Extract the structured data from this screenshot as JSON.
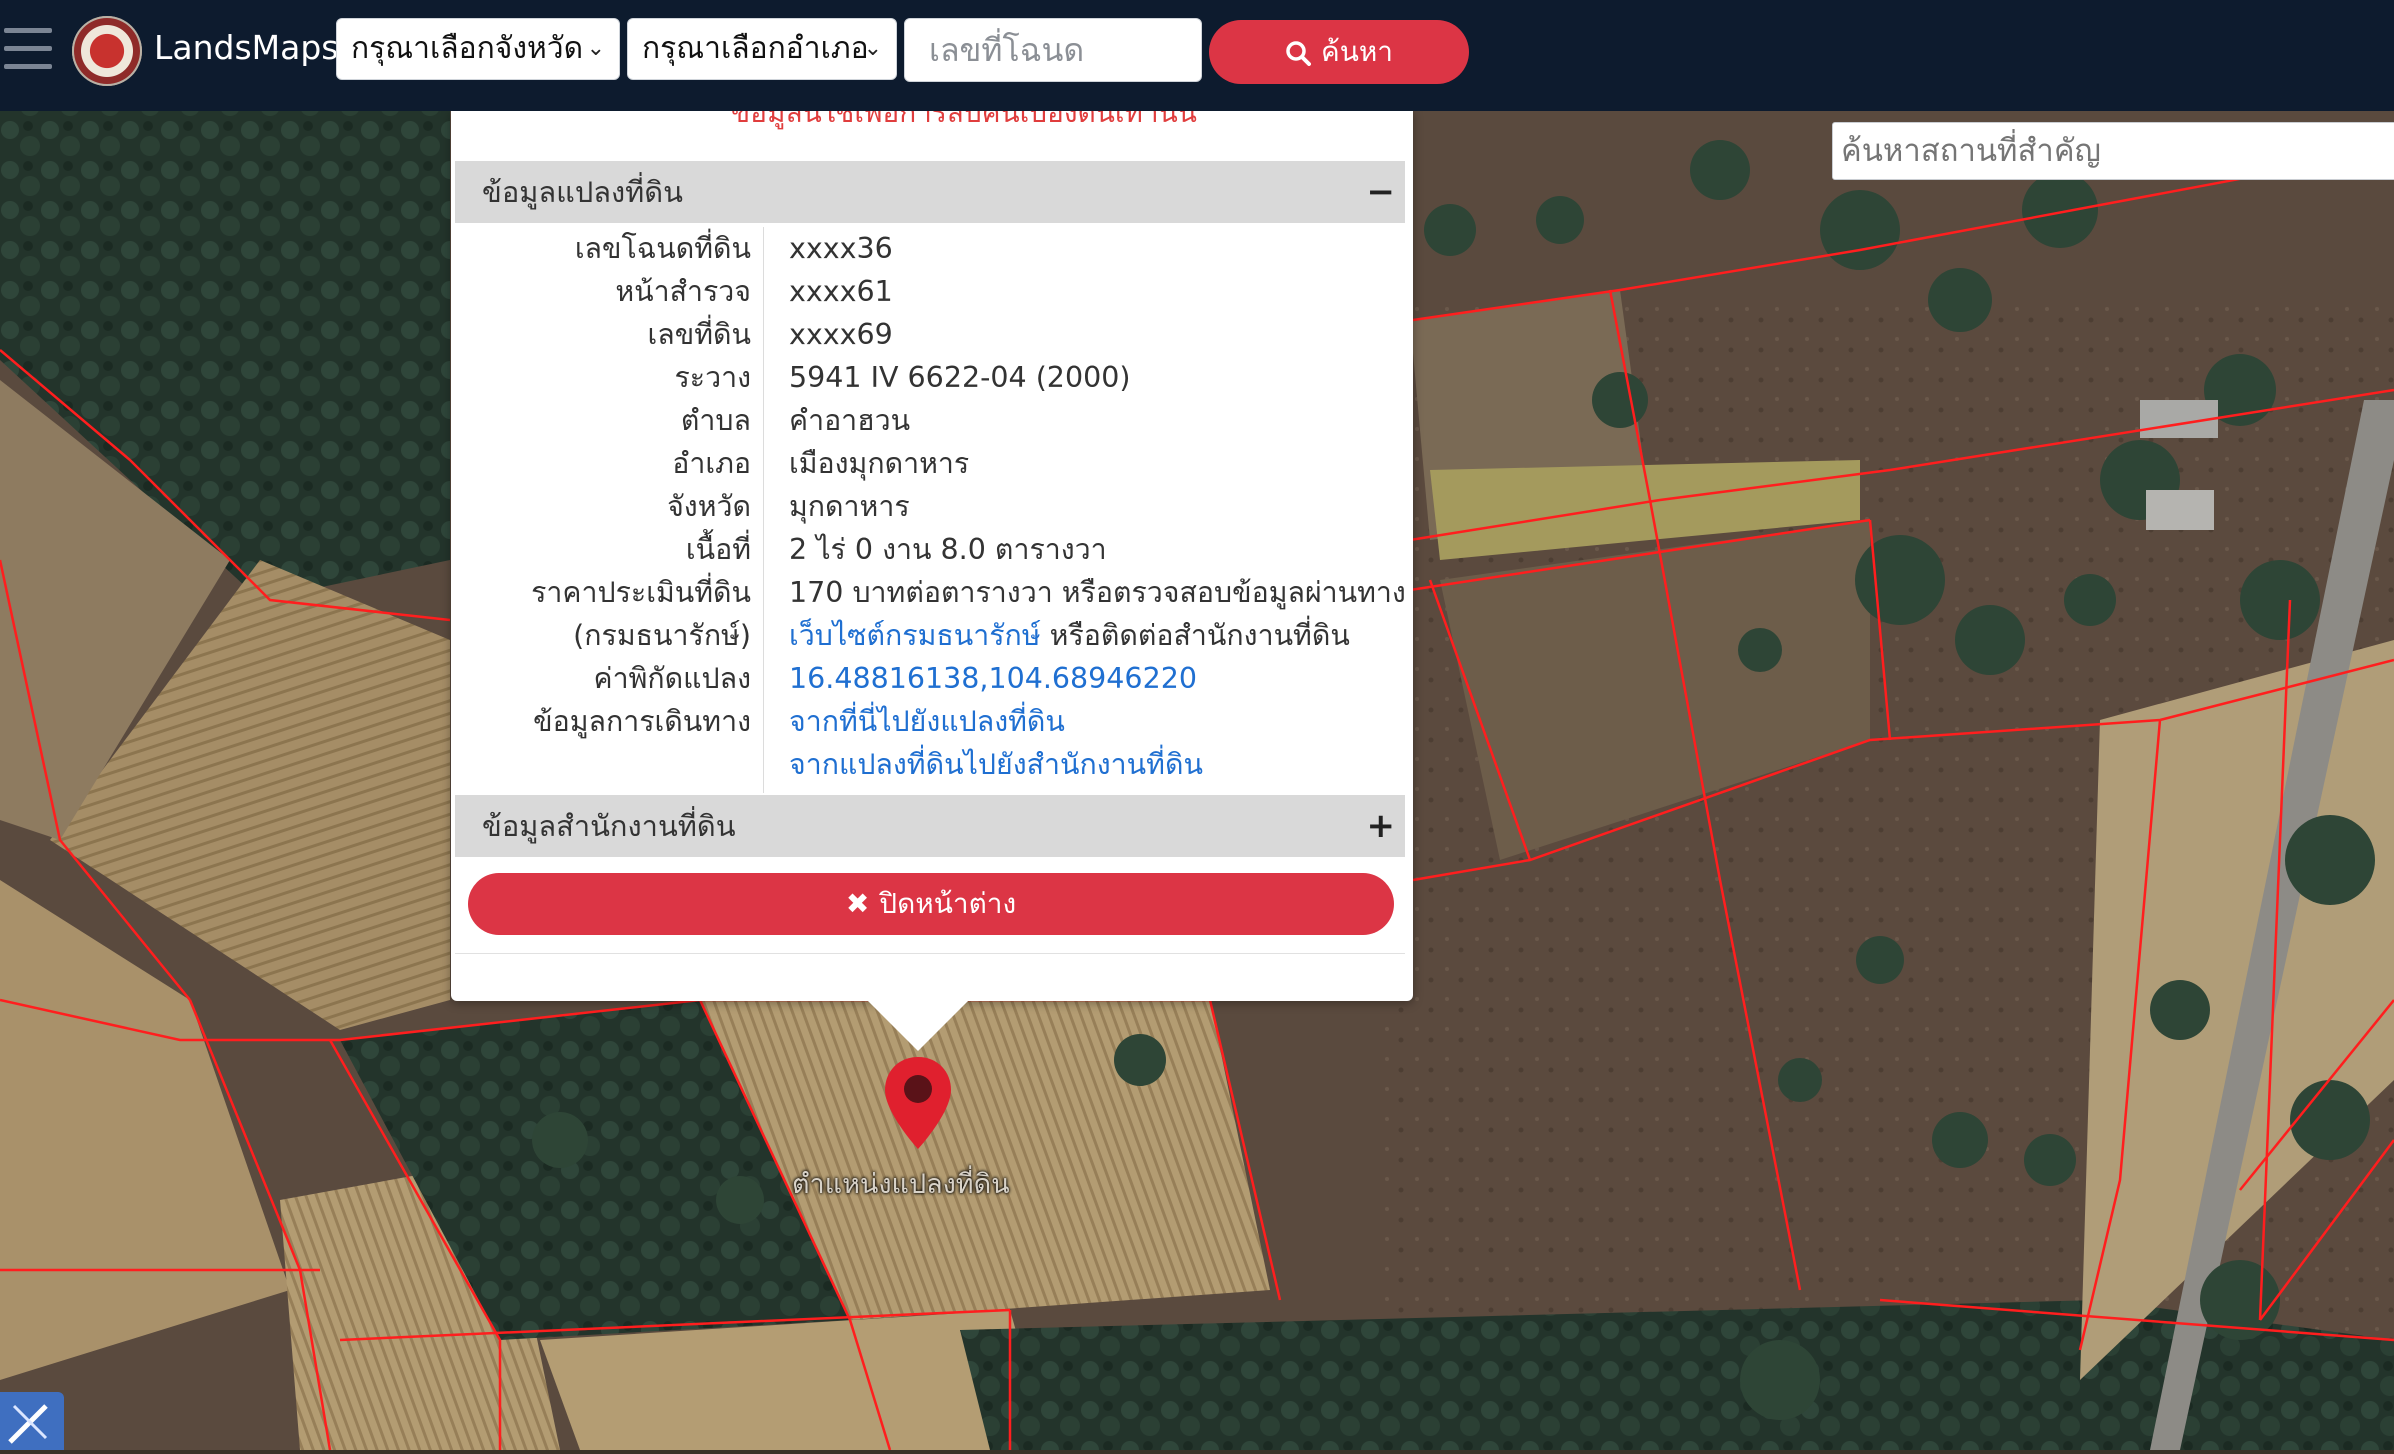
{
  "app": {
    "brand": "LandsMaps"
  },
  "header": {
    "province_select": "กรุณาเลือกจังหวัด",
    "district_select": "กรุณาเลือกอำเภอ",
    "deed_placeholder": "เลขที่โฉนด",
    "search_label": "ค้นหา"
  },
  "landmark_search": {
    "placeholder": "ค้นหาสถานที่สำคัญ"
  },
  "popup": {
    "top_note": "ข้อมูลนี้ใช้เพื่อการสืบค้นเบื้องต้นเท่านั้น",
    "parcel_section": {
      "title": "ข้อมูลแปลงที่ดิน",
      "toggle": "−"
    },
    "office_section": {
      "title": "ข้อมูลสำนักงานที่ดิน",
      "toggle": "+"
    },
    "rows": [
      {
        "label": "เลขโฉนดที่ดิน",
        "value": "xxxx36"
      },
      {
        "label": "หน้าสำรวจ",
        "value": "xxxx61"
      },
      {
        "label": "เลขที่ดิน",
        "value": "xxxx69"
      },
      {
        "label": "ระวาง",
        "value": "5941 IV 6622-04 (2000)"
      },
      {
        "label": "ตำบล",
        "value": "คำอาฮวน"
      },
      {
        "label": "อำเภอ",
        "value": "เมืองมุกดาหาร"
      },
      {
        "label": "จังหวัด",
        "value": "มุกดาหาร"
      },
      {
        "label": "เนื้อที่",
        "value": "2 ไร่ 0 งาน 8.0 ตารางวา"
      },
      {
        "label": "ราคาประเมินที่ดิน",
        "value": "170 บาทต่อตารางวา หรือตรวจสอบข้อมูลผ่านทาง"
      },
      {
        "label": "(กรมธนารักษ์)",
        "link": "เว็บไซต์กรมธนารักษ์",
        "value": " หรือติดต่อสำนักงานที่ดิน"
      },
      {
        "label": "ค่าพิกัดแปลง",
        "link": "16.48816138,104.68946220"
      },
      {
        "label": "ข้อมูลการเดินทาง",
        "link": "จากที่นี่ไปยังแปลงที่ดิน"
      },
      {
        "label": "",
        "link": "จากแปลงที่ดินไปยังสำนักงานที่ดิน"
      }
    ],
    "close_label": "ปิดหน้าต่าง"
  },
  "map": {
    "pin_label": "ตำแหน่งแปลงที่ดิน",
    "parcel_line_color": "#ff1e1e",
    "pin_color": "#e0202e"
  }
}
